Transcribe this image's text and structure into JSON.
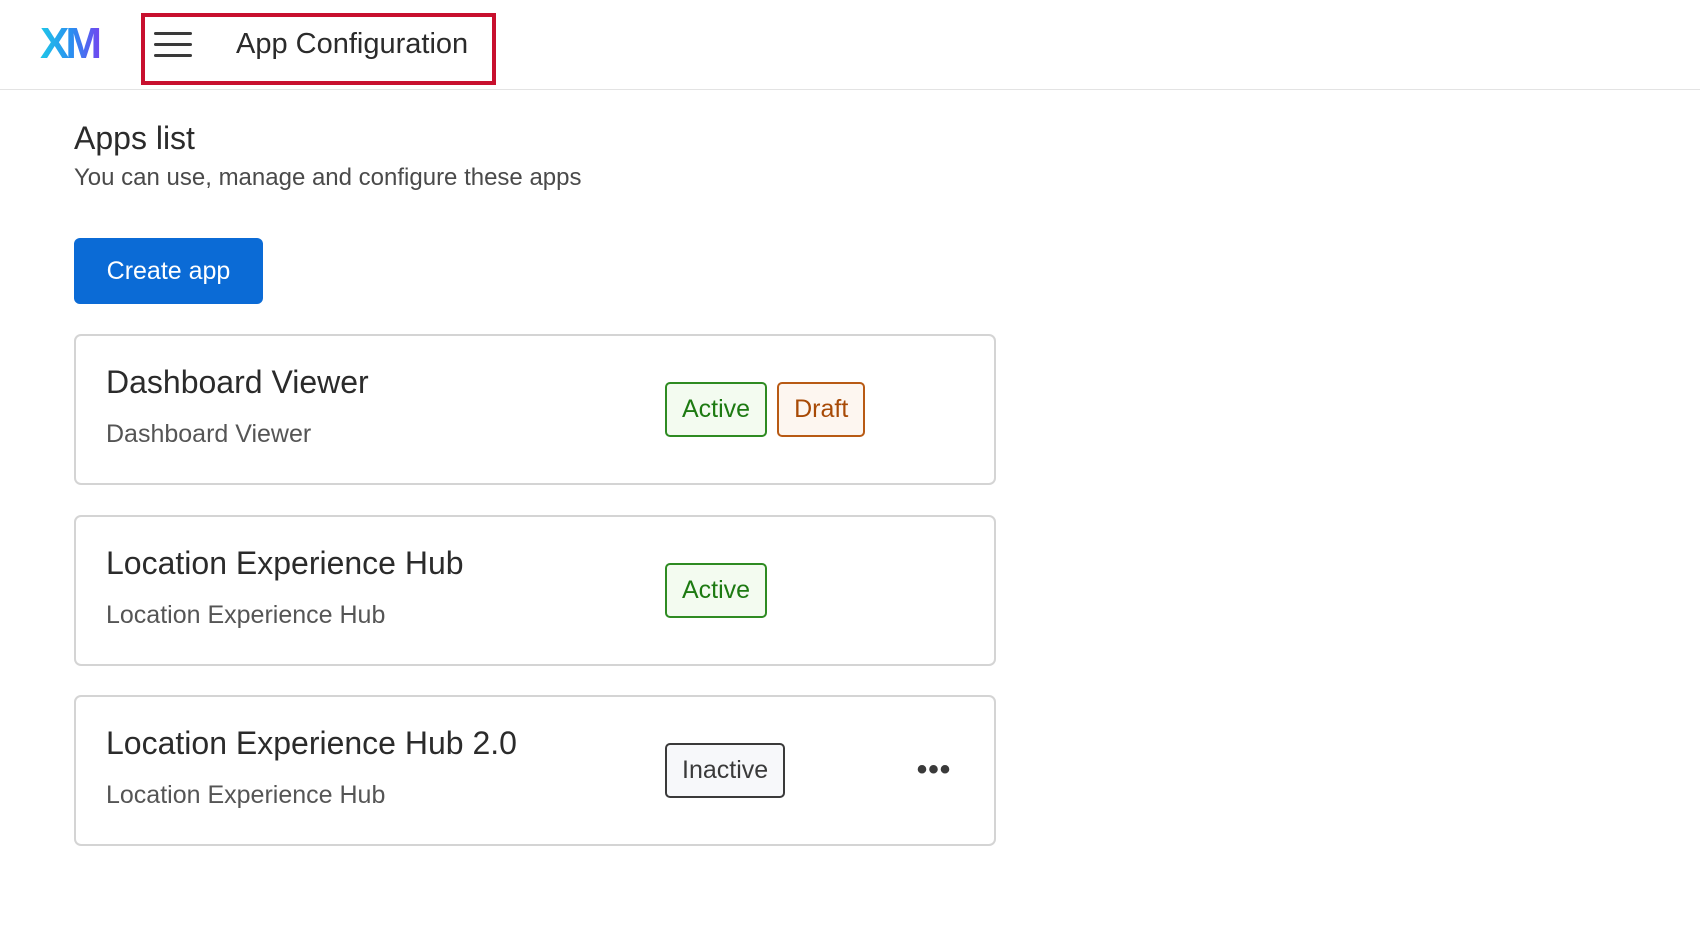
{
  "header": {
    "logo_text": "XM",
    "title": "App Configuration"
  },
  "page": {
    "heading": "Apps list",
    "subheading": "You can use, manage and configure these apps",
    "create_button_label": "Create app"
  },
  "apps": [
    {
      "title": "Dashboard Viewer",
      "subtitle": "Dashboard Viewer",
      "badges": [
        "Active",
        "Draft"
      ]
    },
    {
      "title": "Location Experience Hub",
      "subtitle": "Location Experience Hub",
      "badges": [
        "Active"
      ]
    },
    {
      "title": "Location Experience Hub 2.0",
      "subtitle": "Location Experience Hub",
      "badges": [
        "Inactive"
      ],
      "more_icon": "more-horizontal-icon"
    }
  ],
  "colors": {
    "primary": "#0b6bd6",
    "active": "#2e8b22",
    "draft": "#b85a14",
    "highlight": "#c8102e"
  }
}
